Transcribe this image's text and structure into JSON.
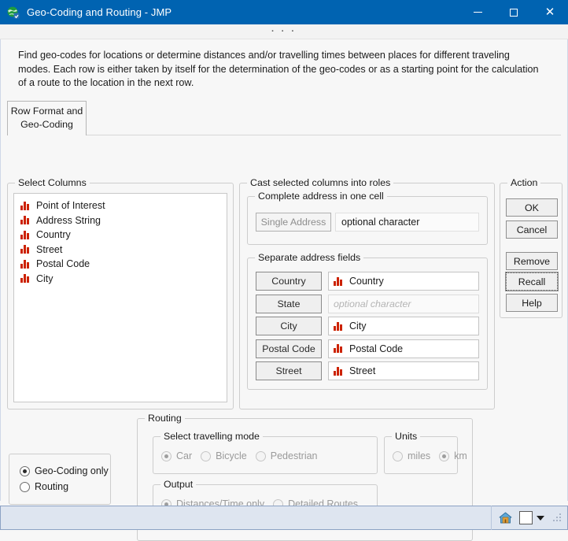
{
  "window": {
    "title": "Geo-Coding and Routing - JMP",
    "icon": "globe-icon",
    "minimize_label": "Minimize",
    "maximize_label": "Maximize",
    "close_label": "Close",
    "toolbar_overflow": "· · ·",
    "titlebar_color": "#0063b1"
  },
  "description": "Find geo-codes for locations or determine distances and/or travelling times between places for different traveling modes. Each row is either taken by itself for the determination of the geo-codes or as a starting point for the calculation of a route to the location in the next row.",
  "tab": {
    "line1": "Row Format and",
    "line2": "Geo-Coding"
  },
  "select_columns": {
    "legend": "Select Columns",
    "items": [
      {
        "label": "Point of Interest",
        "icon": "nominal-bar-icon"
      },
      {
        "label": "Address String",
        "icon": "nominal-bar-icon"
      },
      {
        "label": "Country",
        "icon": "nominal-bar-icon"
      },
      {
        "label": "Street",
        "icon": "nominal-bar-icon"
      },
      {
        "label": "Postal Code",
        "icon": "nominal-bar-icon"
      },
      {
        "label": "City",
        "icon": "nominal-bar-icon"
      }
    ]
  },
  "cast_roles": {
    "legend": "Cast selected columns into roles",
    "complete_address": {
      "legend": "Complete address in one cell",
      "button_label": "Single Address",
      "field_placeholder": "optional character",
      "field_value": "",
      "disabled": true
    },
    "separate_fields": {
      "legend": "Separate address fields",
      "rows": [
        {
          "button_label": "Country",
          "value": "Country",
          "placeholder": "optional character",
          "icon": "nominal-bar-icon"
        },
        {
          "button_label": "State",
          "value": "",
          "placeholder": "optional character",
          "icon": ""
        },
        {
          "button_label": "City",
          "value": "City",
          "placeholder": "optional character",
          "icon": "nominal-bar-icon"
        },
        {
          "button_label": "Postal Code",
          "value": "Postal Code",
          "placeholder": "optional character",
          "icon": "nominal-bar-icon"
        },
        {
          "button_label": "Street",
          "value": "Street",
          "placeholder": "optional character",
          "icon": "nominal-bar-icon"
        }
      ]
    }
  },
  "action": {
    "legend": "Action",
    "ok": "OK",
    "cancel": "Cancel",
    "remove": "Remove",
    "recall": "Recall",
    "help": "Help"
  },
  "mode": {
    "geocoding_only": "Geo-Coding only",
    "routing": "Routing",
    "selected": "Geo-Coding only"
  },
  "routing": {
    "legend": "Routing",
    "travel_mode": {
      "legend": "Select travelling mode",
      "options": [
        "Car",
        "Bicycle",
        "Pedestrian"
      ],
      "selected": "Car",
      "disabled": true
    },
    "units": {
      "legend": "Units",
      "options": [
        "miles",
        "km"
      ],
      "selected": "km",
      "disabled": true
    },
    "output": {
      "legend": "Output",
      "options": [
        "Distances/Time only",
        "Detailed Routes"
      ],
      "selected": "Distances/Time only",
      "disabled": true
    }
  },
  "statusbar": {
    "home_icon": "home-icon",
    "square_button": "white-square-button",
    "dropdown": "chevron-down-icon",
    "resize_grip": "resize-grip"
  }
}
